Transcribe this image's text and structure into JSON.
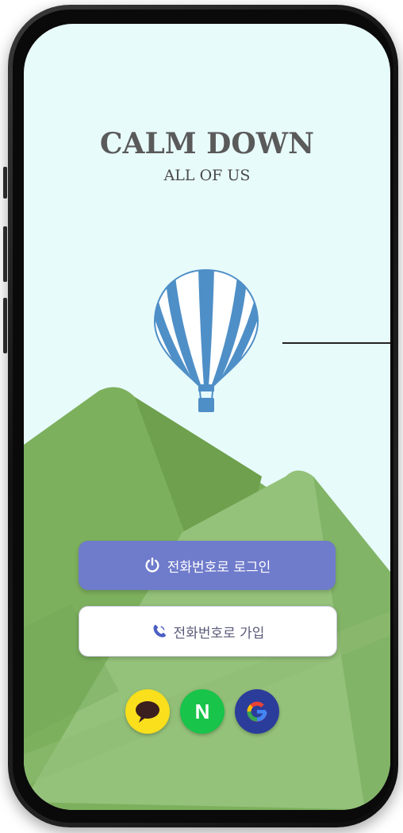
{
  "app": {
    "title": "CALM DOWN",
    "subtitle": "ALL OF US"
  },
  "buttons": {
    "login_label": "전화번호로 로그인",
    "signup_label": "전화번호로 가입",
    "login_icon": "power-icon",
    "signup_icon": "phone-icon"
  },
  "social": [
    {
      "name": "kakao-icon",
      "color": "#f9df1c"
    },
    {
      "name": "naver-icon",
      "color": "#18c44a",
      "letter": "N"
    },
    {
      "name": "google-icon",
      "color": "#2b3d9a"
    }
  ],
  "colors": {
    "background": "#e8fbfb",
    "primary_button": "#6f7bcb",
    "title": "#5a5a5a",
    "balloon": "#4f8fc7"
  }
}
